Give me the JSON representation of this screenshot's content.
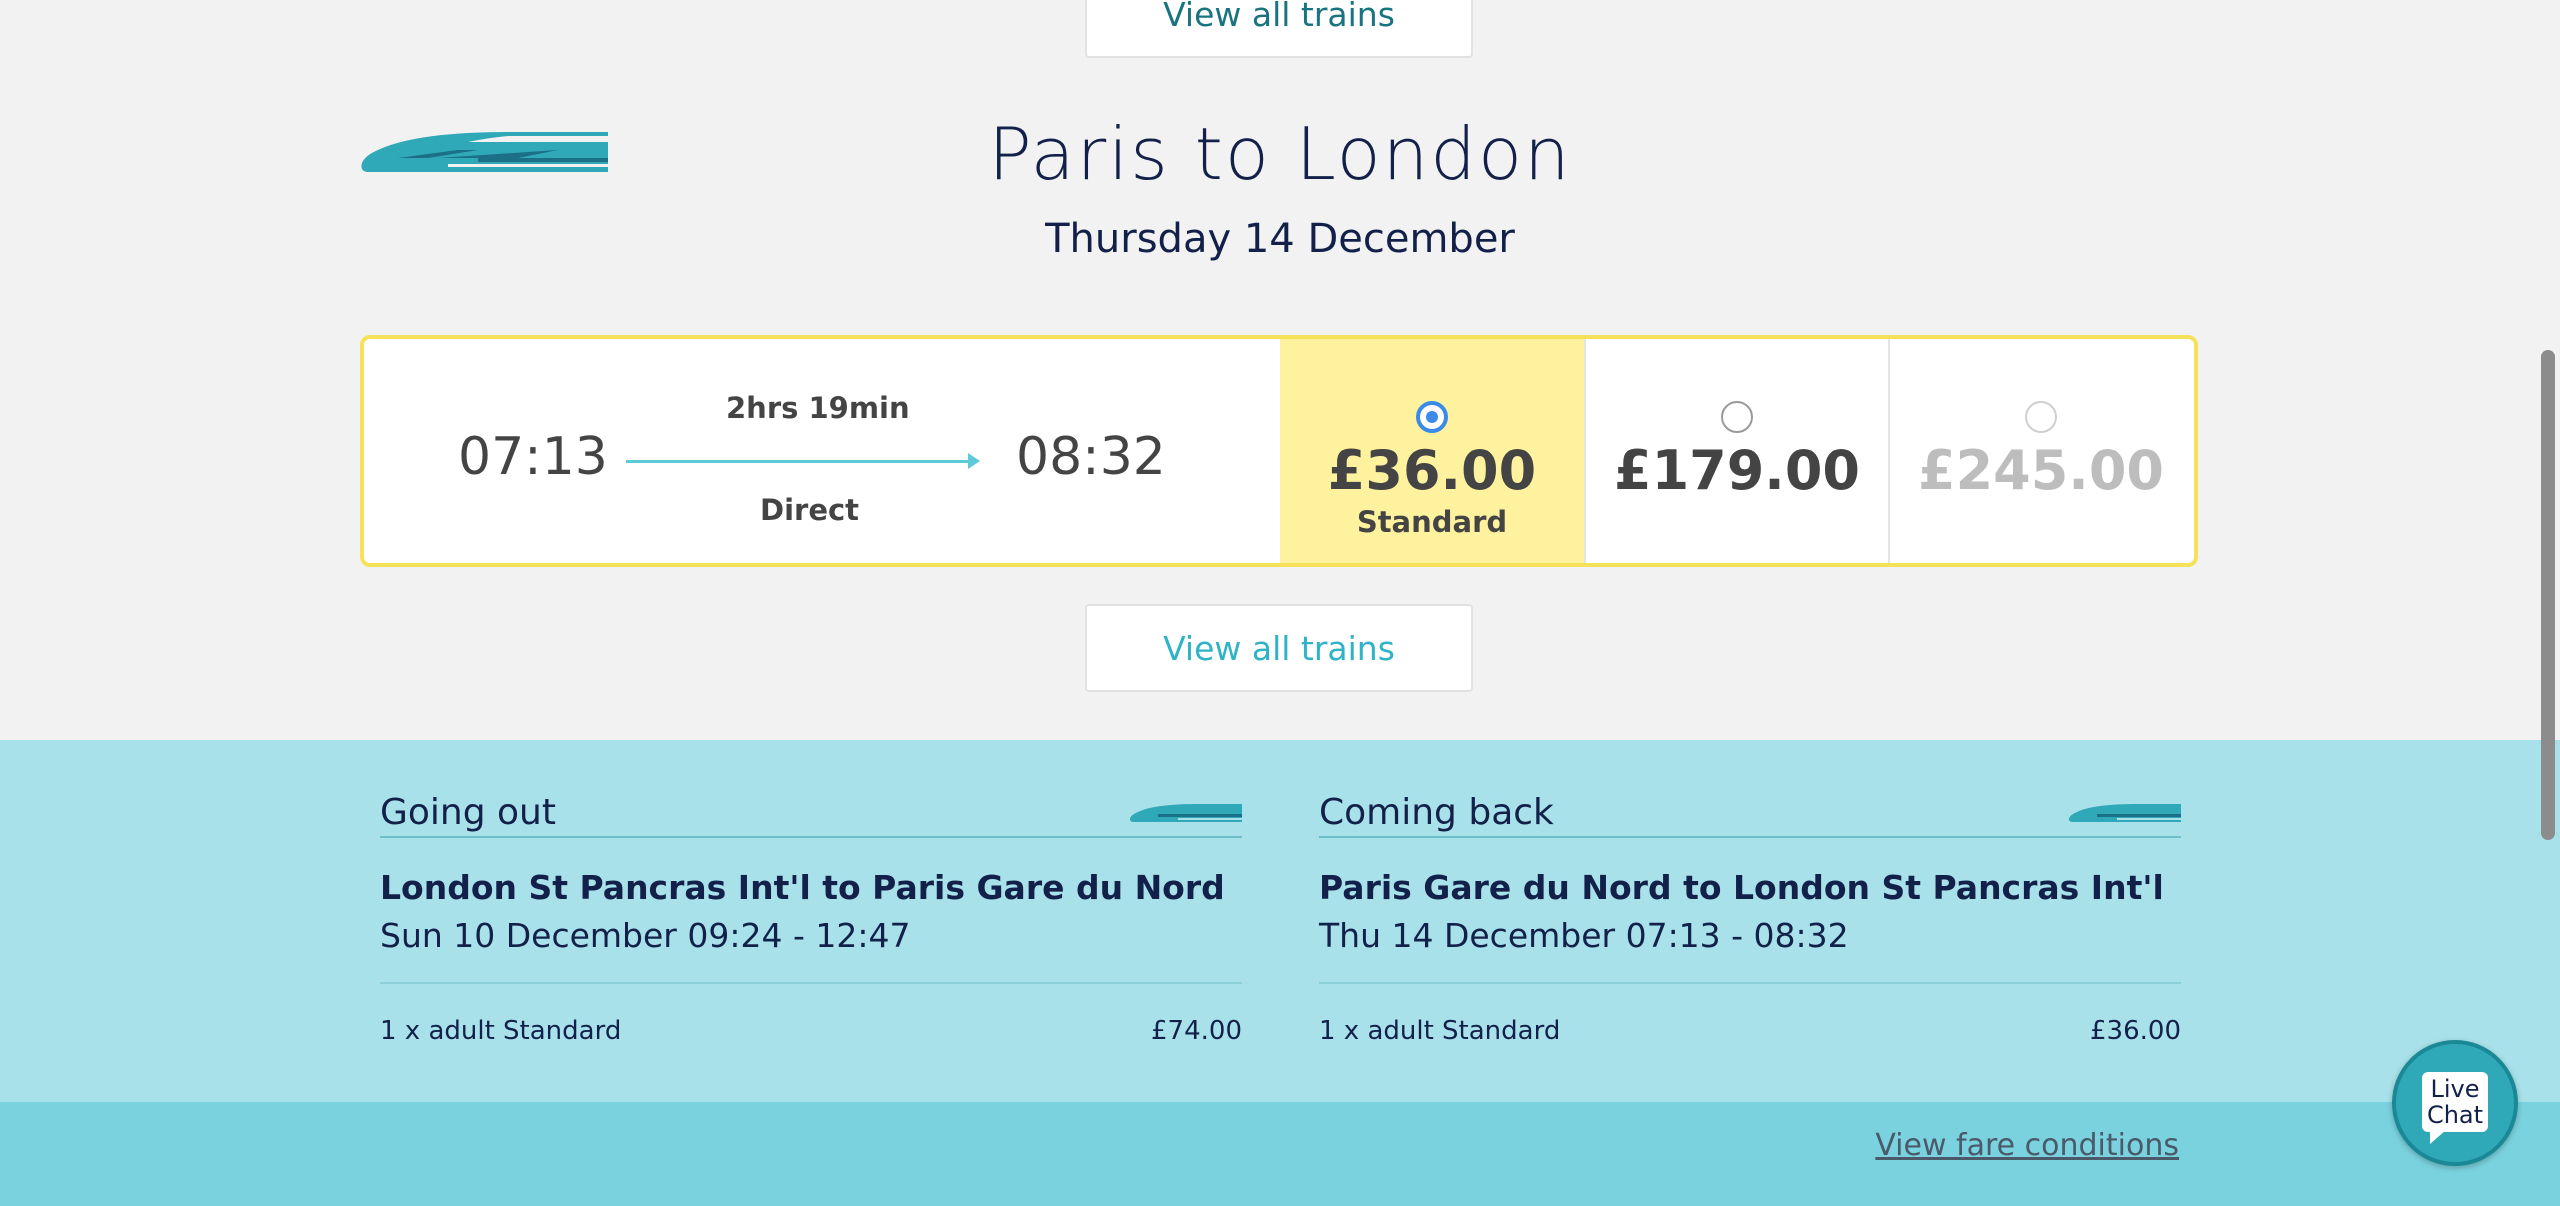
{
  "top_button": {
    "label": "View all trains"
  },
  "header": {
    "title": "Paris to London",
    "date": "Thursday 14 December"
  },
  "journey": {
    "departure": "07:13",
    "arrival": "08:32",
    "duration": "2hrs 19min",
    "stops": "Direct",
    "fares": [
      {
        "price": "£36.00",
        "class": "Standard",
        "selected": true,
        "available": true
      },
      {
        "price": "£179.00",
        "class": "",
        "selected": false,
        "available": true
      },
      {
        "price": "£245.00",
        "class": "",
        "selected": false,
        "available": false
      }
    ]
  },
  "mid_button": {
    "label": "View all trains"
  },
  "summary": {
    "outbound": {
      "heading": "Going out",
      "route": "London St Pancras Int'l to Paris Gare du Nord",
      "when": "Sun 10 December 09:24 - 12:47",
      "passengers": "1 x adult Standard",
      "amount": "£74.00"
    },
    "return": {
      "heading": "Coming back",
      "route": "Paris Gare du Nord to London St Pancras Int'l",
      "when": "Thu 14 December 07:13 - 08:32",
      "passengers": "1 x adult Standard",
      "amount": "£36.00"
    }
  },
  "footer": {
    "fare_conditions_link": "View fare conditions"
  },
  "live_chat": {
    "line1": "Live",
    "line2": "Chat"
  },
  "colors": {
    "accent": "#2fb3c6",
    "selected_fare": "#fff29e",
    "card_border": "#f5e25a",
    "summary_bg": "#a8e1e9",
    "radio_selected": "#3a8be8"
  }
}
